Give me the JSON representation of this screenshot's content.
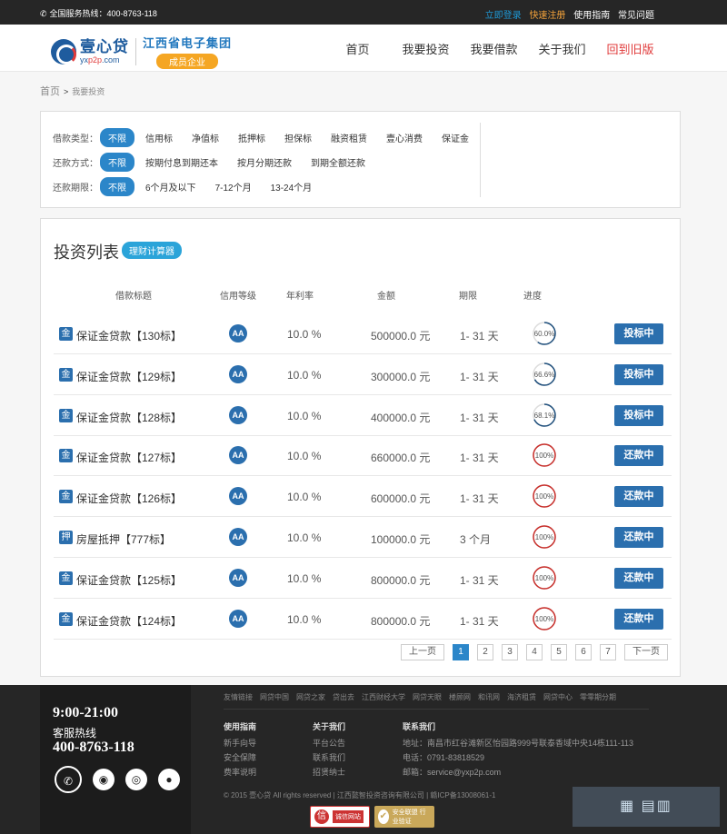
{
  "topbar": {
    "hotline": "全国服务热线：400-8763-118",
    "login": "立即登录",
    "register": "快速注册",
    "guide": "使用指南",
    "faq": "常见问题"
  },
  "brand": {
    "name": "壹心贷",
    "url_prefix": "yx",
    "url_mid": "p2p",
    "url_suffix": ".com",
    "group_name": "江西省电子集团",
    "group_tag": "成员企业"
  },
  "nav": [
    "首页",
    "我要投资",
    "我要借款",
    "关于我们",
    "回到旧版"
  ],
  "breadcrumb": {
    "home": "首页",
    "sep": ">",
    "current": "我要投资"
  },
  "filters": [
    {
      "label": "借款类型：",
      "options": [
        "不限",
        "信用标",
        "净值标",
        "抵押标",
        "担保标",
        "融资租赁",
        "壹心消费",
        "保证金"
      ]
    },
    {
      "label": "还款方式：",
      "options": [
        "不限",
        "按期付息到期还本",
        "按月分期还款",
        "到期全额还款"
      ]
    },
    {
      "label": "还款期限：",
      "options": [
        "不限",
        "6个月及以下",
        "7-12个月",
        "13-24个月"
      ]
    }
  ],
  "list": {
    "title": "投资列表",
    "calc_button": "理财计算器",
    "headers": [
      "借款标题",
      "信用等级",
      "年利率",
      "金额",
      "期限",
      "进度"
    ],
    "rows": [
      {
        "badge": "金",
        "name": "保证金贷款【130标】",
        "grade": "AA",
        "rate": "10.0 %",
        "amount": "500000.0 元",
        "term": "1- 31 天",
        "progress": 60.0,
        "progress_label": "60.0%",
        "action": "投标中"
      },
      {
        "badge": "金",
        "name": "保证金贷款【129标】",
        "grade": "AA",
        "rate": "10.0 %",
        "amount": "300000.0 元",
        "term": "1- 31 天",
        "progress": 66.6,
        "progress_label": "66.6%",
        "action": "投标中"
      },
      {
        "badge": "金",
        "name": "保证金贷款【128标】",
        "grade": "AA",
        "rate": "10.0 %",
        "amount": "400000.0 元",
        "term": "1- 31 天",
        "progress": 68.1,
        "progress_label": "68.1%",
        "action": "投标中"
      },
      {
        "badge": "金",
        "name": "保证金贷款【127标】",
        "grade": "AA",
        "rate": "10.0 %",
        "amount": "660000.0 元",
        "term": "1- 31 天",
        "progress": 100,
        "progress_label": "100%",
        "action": "还款中"
      },
      {
        "badge": "金",
        "name": "保证金贷款【126标】",
        "grade": "AA",
        "rate": "10.0 %",
        "amount": "600000.0 元",
        "term": "1- 31 天",
        "progress": 100,
        "progress_label": "100%",
        "action": "还款中"
      },
      {
        "badge": "押",
        "name": "房屋抵押【777标】",
        "grade": "AA",
        "rate": "10.0 %",
        "amount": "100000.0 元",
        "term": "3 个月",
        "progress": 100,
        "progress_label": "100%",
        "action": "还款中"
      },
      {
        "badge": "金",
        "name": "保证金贷款【125标】",
        "grade": "AA",
        "rate": "10.0 %",
        "amount": "800000.0 元",
        "term": "1- 31 天",
        "progress": 100,
        "progress_label": "100%",
        "action": "还款中"
      },
      {
        "badge": "金",
        "name": "保证金贷款【124标】",
        "grade": "AA",
        "rate": "10.0 %",
        "amount": "800000.0 元",
        "term": "1- 31 天",
        "progress": 100,
        "progress_label": "100%",
        "action": "还款中"
      }
    ]
  },
  "pager": {
    "prev": "上一页",
    "pages": [
      "1",
      "2",
      "3",
      "4",
      "5",
      "6",
      "7"
    ],
    "current": "1",
    "next": "下一页"
  },
  "footer": {
    "hours": "9:00-21:00",
    "service_label": "客服热线",
    "service_number": "400-8763-118",
    "social_icons": [
      "phone-icon",
      "wechat-icon",
      "weibo-icon",
      "qq-icon"
    ],
    "friend_links": [
      "友情链接",
      "网贷中国",
      "网贷之家",
      "贷出去",
      "江西财经大学",
      "网贷天眼",
      "楼顾网",
      "和讯网",
      "海济租赁",
      "网贷中心",
      "零零期分期"
    ],
    "col_guide": {
      "title": "使用指南",
      "items": [
        "新手向导",
        "安全保障",
        "费率说明"
      ]
    },
    "col_about": {
      "title": "关于我们",
      "items": [
        "平台公告",
        "联系我们",
        "招贤纳士"
      ]
    },
    "col_contact": {
      "title": "联系我们",
      "items": [
        "地址：南昌市红谷滩新区怡园路999号联泰香域中央14栋111-113",
        "电话：0791-83818529",
        "邮箱：service@yxp2p.com"
      ]
    },
    "copyright": "© 2015 壹心贷 All rights reserved  | 江西懿智投资咨询有限公司 | 赣ICP备13008061-1",
    "cert1_icon": "信",
    "cert1": "诚信网站",
    "cert2": "安全联盟 行业验证"
  },
  "colors": {
    "accent": "#2b86c9",
    "brand_blue": "#2b6fae",
    "progress_open": "#1f4f7c",
    "progress_done": "#c9302c",
    "old_version": "#e03a3a"
  }
}
